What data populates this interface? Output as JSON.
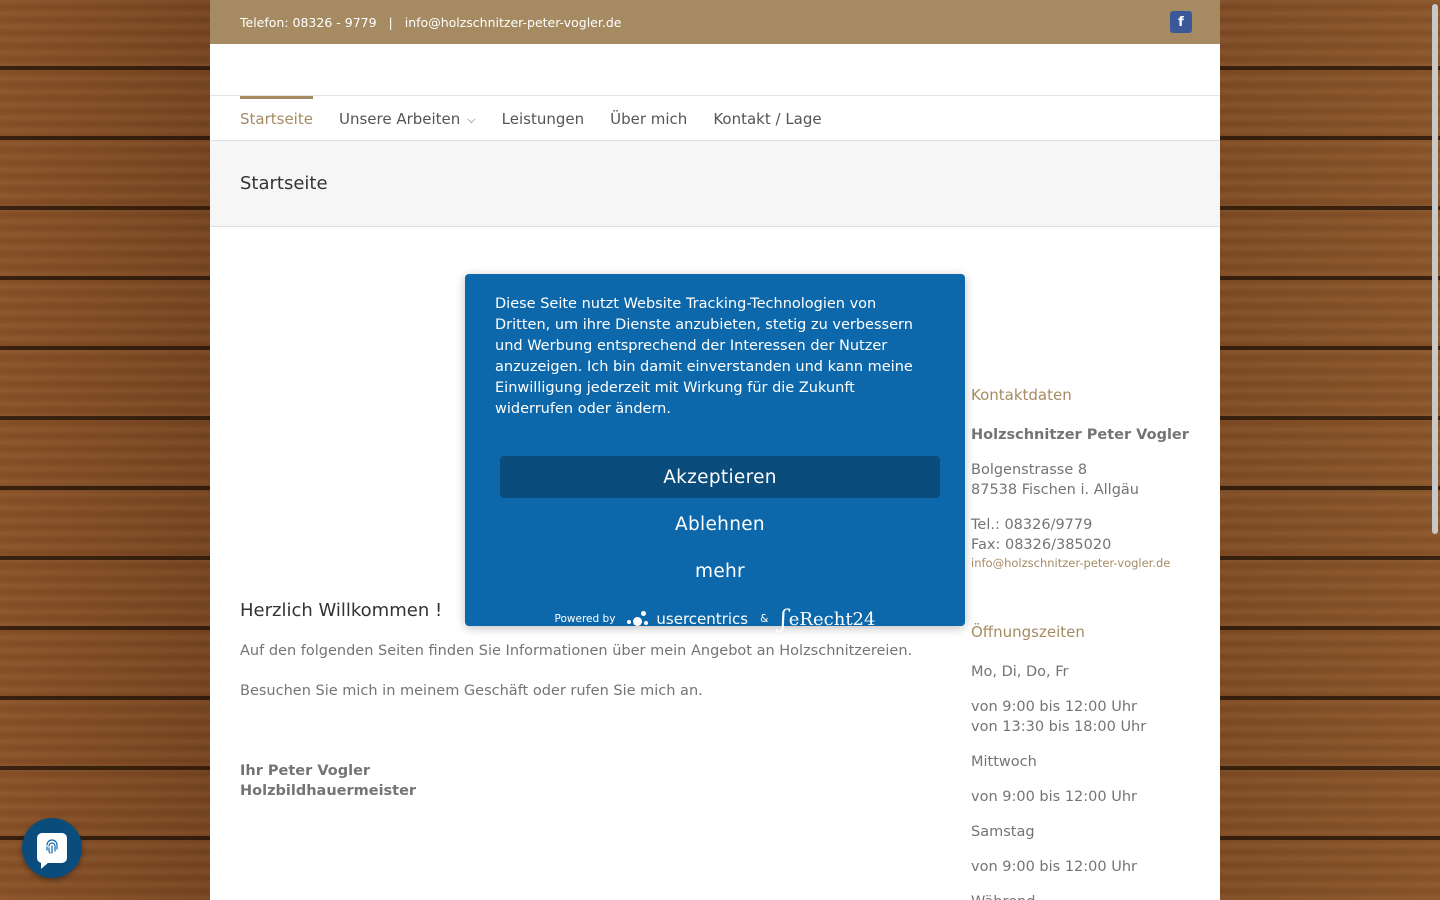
{
  "topbar": {
    "phone": "Telefon: 08326 - 9779",
    "separator": "|",
    "email": "info@holzschnitzer-peter-vogler.de",
    "facebook_glyph": "f"
  },
  "nav": {
    "items": [
      {
        "label": "Startseite"
      },
      {
        "label": "Unsere Arbeiten"
      },
      {
        "label": "Leistungen"
      },
      {
        "label": "Über mich"
      },
      {
        "label": "Kontakt / Lage"
      }
    ],
    "dropdown_glyph": "⌵"
  },
  "page_title": "Startseite",
  "main": {
    "heading": "Herzlich Willkommen !",
    "p1": "Auf den folgenden Seiten finden Sie Informationen über mein Angebot an Holzschnitzereien.",
    "p2": "Besuchen Sie mich in meinem Geschäft oder rufen Sie mich an.",
    "sig_name": "Ihr Peter Vogler",
    "sig_title": "Holzbildhauermeister"
  },
  "sidebar": {
    "contact_heading": "Kontaktdaten",
    "company": "Holzschnitzer Peter Vogler",
    "street": "Bolgenstrasse 8",
    "city": "87538 Fischen i. Allgäu",
    "tel": "Tel.: 08326/9779",
    "fax": "Fax: 08326/385020",
    "email": "info@holzschnitzer-peter-vogler.de",
    "hours_heading": "Öffnungszeiten",
    "hours": [
      "Mo, Di, Do, Fr",
      "von 9:00 bis 12:00 Uhr",
      "von 13:30 bis 18:00 Uhr",
      "Mittwoch",
      "von 9:00 bis 12:00 Uhr",
      "Samstag",
      "von 9:00 bis 12:00 Uhr",
      "Während ..."
    ]
  },
  "cookie": {
    "text": "Diese Seite nutzt Website Tracking-Technologien von Dritten, um ihre Dienste anzubieten, stetig zu verbessern und Werbung entsprechend der Interessen der Nutzer anzuzeigen. Ich bin damit einverstanden und kann meine Einwilligung jederzeit mit Wirkung für die Zukunft widerrufen oder ändern.",
    "accept_label": "Akzeptieren",
    "decline_label": "Ablehnen",
    "more_label": "mehr",
    "powered_by": "Powered by",
    "usercentrics": "usercentrics",
    "ampersand": "&",
    "erecht": "eRecht24",
    "erecht_swirl": "ʃ"
  },
  "colors": {
    "accent": "#a68b62",
    "cookie_bg": "#0d68ab",
    "accept_bg": "#0a4c7c"
  }
}
